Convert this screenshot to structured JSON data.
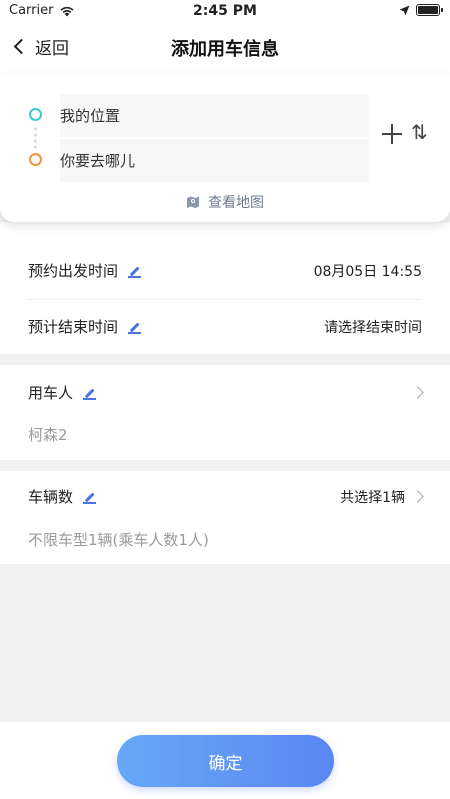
{
  "status_bar": {
    "carrier": "Carrier",
    "time": "2:45 PM"
  },
  "nav": {
    "back_label": "返回",
    "title": "添加用车信息"
  },
  "route": {
    "start_text": "我的位置",
    "end_text": "你要去哪儿",
    "swap_icon_text": "⇅",
    "map_link_label": "查看地图",
    "start_color": "#3cc6d0",
    "end_color": "#f0963c"
  },
  "schedule": {
    "depart_label": "预约出发时间",
    "depart_value": "08月05日 14:55",
    "end_label": "预计结束时间",
    "end_value": "请选择结束时间"
  },
  "user": {
    "label": "用车人",
    "value": "柯森2"
  },
  "vehicles": {
    "label": "车辆数",
    "summary": "共选择1辆",
    "detail": "不限车型1辆(乘车人数1人)"
  },
  "footer": {
    "confirm_label": "确定",
    "accent": "#5a86f2"
  }
}
